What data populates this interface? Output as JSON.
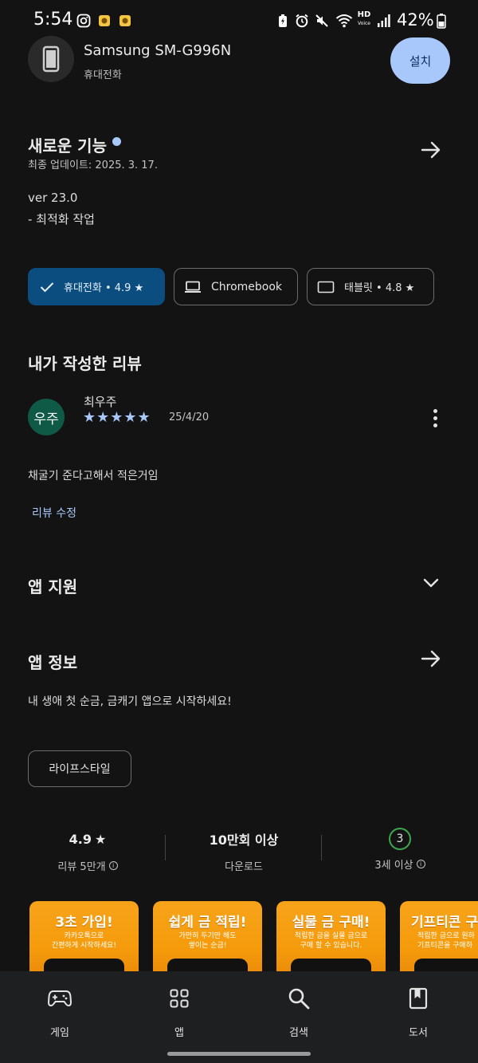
{
  "status_bar": {
    "time": "5:54",
    "hd_label": "HD",
    "voice_label": "Voice",
    "battery": "42%"
  },
  "device": {
    "name": "Samsung SM-G996N",
    "type": "휴대전화",
    "install_label": "설치"
  },
  "whats_new": {
    "title": "새로운 기능",
    "updated": "최종 업데이트: 2025. 3. 17.",
    "version": "ver 23.0",
    "note": "- 최적화 작업"
  },
  "device_chips": [
    {
      "label": "휴대전화 • 4.9 ★",
      "selected": true,
      "icon": "check-icon"
    },
    {
      "label": "Chromebook",
      "selected": false,
      "icon": "laptop-icon"
    },
    {
      "label": "태블릿 • 4.8 ★",
      "selected": false,
      "icon": "tablet-icon"
    }
  ],
  "my_review": {
    "section_title": "내가 작성한 리뷰",
    "avatar_text": "우주",
    "reviewer": "최우주",
    "stars": "★★★★★",
    "rating": 5,
    "date": "25/4/20",
    "text": "채굴기 준다고해서 적은거임",
    "edit_label": "리뷰 수정"
  },
  "app_support": {
    "title": "앱 지원"
  },
  "app_info": {
    "title": "앱 정보",
    "description": "내 생애 첫 순금, 금캐기 앱으로 시작하세요!",
    "category": "라이프스타일"
  },
  "stats": {
    "rating_value": "4.9",
    "rating_label": "리뷰 5만개",
    "downloads_value": "10만회 이상",
    "downloads_label": "다운로드",
    "age_value": "3",
    "age_label": "3세 이상"
  },
  "screenshots": [
    {
      "title": "3초 가입!",
      "subtitle": "카카오톡으로\n간편하게 시작하세요!"
    },
    {
      "title": "쉽게 금 적립!",
      "subtitle": "가만히 두기만 해도\n쌓이는 순금!"
    },
    {
      "title": "실물 금 구매!",
      "subtitle": "적립한 금을 실물 금으로\n구매 할 수 있습니다."
    },
    {
      "title": "기프티콘 구",
      "subtitle": "적립한 금으로 원하\n기프티콘을 구매하"
    }
  ],
  "bottom_nav": [
    {
      "label": "게임",
      "icon": "gamepad-icon"
    },
    {
      "label": "앱",
      "icon": "apps-grid-icon"
    },
    {
      "label": "검색",
      "icon": "search-icon"
    },
    {
      "label": "도서",
      "icon": "book-icon"
    }
  ],
  "colors": {
    "background": "#131313",
    "accent": "#a8c7fa",
    "selected_chip": "#0b4d7e",
    "avatar": "#0f5a46",
    "age_badge": "#3fa84f",
    "screenshot_orange": "#f7a31a"
  }
}
